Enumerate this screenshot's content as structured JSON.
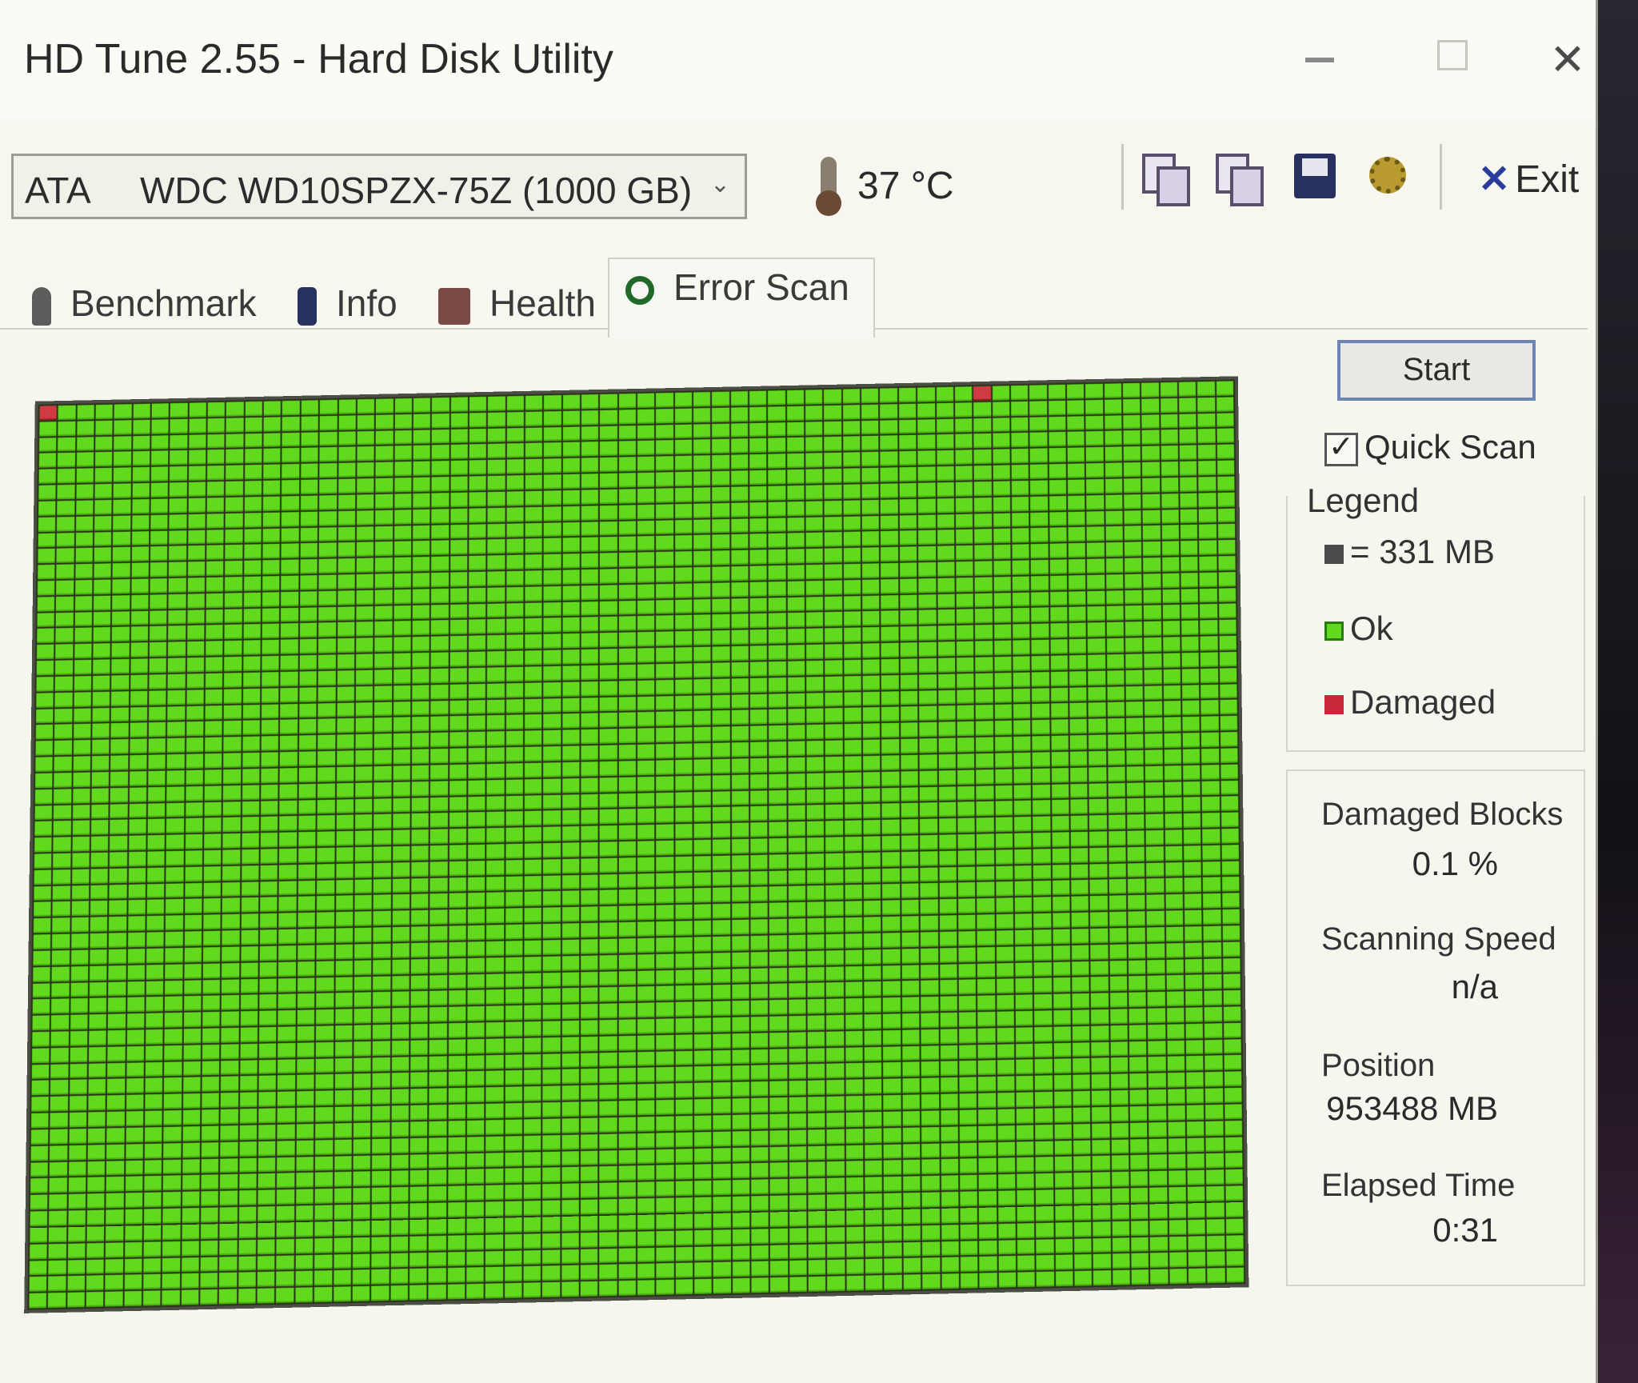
{
  "window": {
    "title": "HD Tune 2.55 - Hard Disk Utility",
    "close_glyph": "✕"
  },
  "toolbar": {
    "drive": "ATA     WDC WD10SPZX-75Z (1000 GB)",
    "drive_arrow": "⌄",
    "temperature": "37 °C",
    "exit_label": "Exit",
    "exit_glyph": "✕",
    "icons": [
      "copy-text-icon",
      "copy-screen-icon",
      "save-icon",
      "options-icon"
    ]
  },
  "tabs": [
    {
      "label": "Benchmark",
      "icon": "benchmark-icon"
    },
    {
      "label": "Info",
      "icon": "info-icon"
    },
    {
      "label": "Health",
      "icon": "health-icon"
    },
    {
      "label": "Error Scan",
      "icon": "magnifier-icon",
      "active": true
    }
  ],
  "scan": {
    "columns": 64,
    "rows": 56,
    "damaged_blocks": [
      0,
      50
    ],
    "colors": {
      "ok": "#61d91c",
      "damaged": "#d03a42"
    }
  },
  "controls": {
    "start_label": "Start",
    "quick_scan_label": "Quick Scan",
    "quick_scan_checked": true
  },
  "legend": {
    "title": "Legend",
    "block_size": "= 331 MB",
    "ok": "Ok",
    "damaged": "Damaged"
  },
  "stats": {
    "damaged_blocks_label": "Damaged Blocks",
    "damaged_blocks_value": "0.1 %",
    "scanning_speed_label": "Scanning Speed",
    "scanning_speed_value": "n/a",
    "position_label": "Position",
    "position_value": "953488 MB",
    "elapsed_label": "Elapsed Time",
    "elapsed_value": "0:31"
  }
}
